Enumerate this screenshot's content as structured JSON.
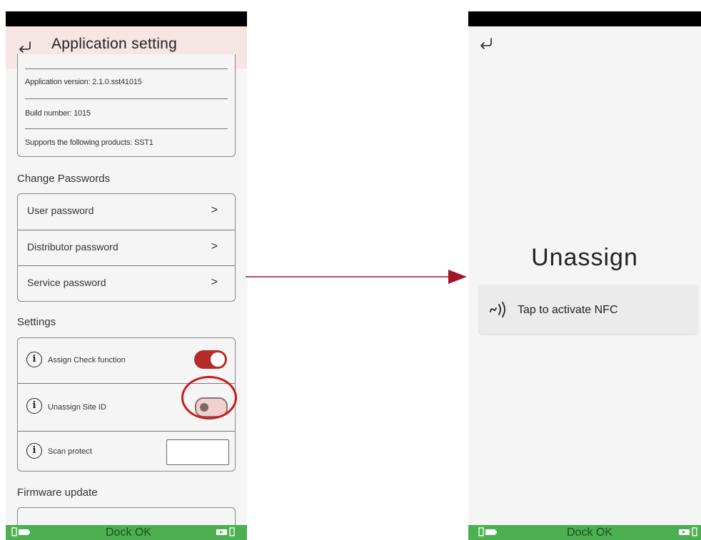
{
  "left": {
    "header": {
      "title": "Application setting",
      "back_icon": "back-arrow-icon"
    },
    "info": {
      "version": "Application version: 2.1.0.sst41015",
      "build": "Build number: 1015",
      "products": "Supports the following products: SST1"
    },
    "passwords": {
      "title": "Change Passwords",
      "items": [
        {
          "label": "User password",
          "chevron": ">"
        },
        {
          "label": "Distributor password",
          "chevron": ">"
        },
        {
          "label": "Service password",
          "chevron": ">"
        }
      ]
    },
    "settings": {
      "title": "Settings",
      "items": [
        {
          "icon": "i",
          "label": "Assign Check function",
          "state": "on"
        },
        {
          "icon": "i",
          "label": "Unassign Site ID",
          "state": "off"
        },
        {
          "icon": "i",
          "label": "Scan protect",
          "value": ""
        }
      ]
    },
    "firmware": {
      "title": "Firmware update"
    },
    "bottom_bar": {
      "text": "Dock OK"
    }
  },
  "right": {
    "back_icon": "back-arrow-icon",
    "title": "Unassign",
    "nfc": {
      "label": "Tap to activate NFC",
      "icon": "nfc-icon"
    },
    "bottom_bar": {
      "text": "Dock OK"
    }
  },
  "colors": {
    "accent": "#b52b2b",
    "header_bg": "#f5e5e3",
    "status_green": "#4caf50",
    "arrow": "#a0142a",
    "highlight": "#cc1a1a"
  }
}
